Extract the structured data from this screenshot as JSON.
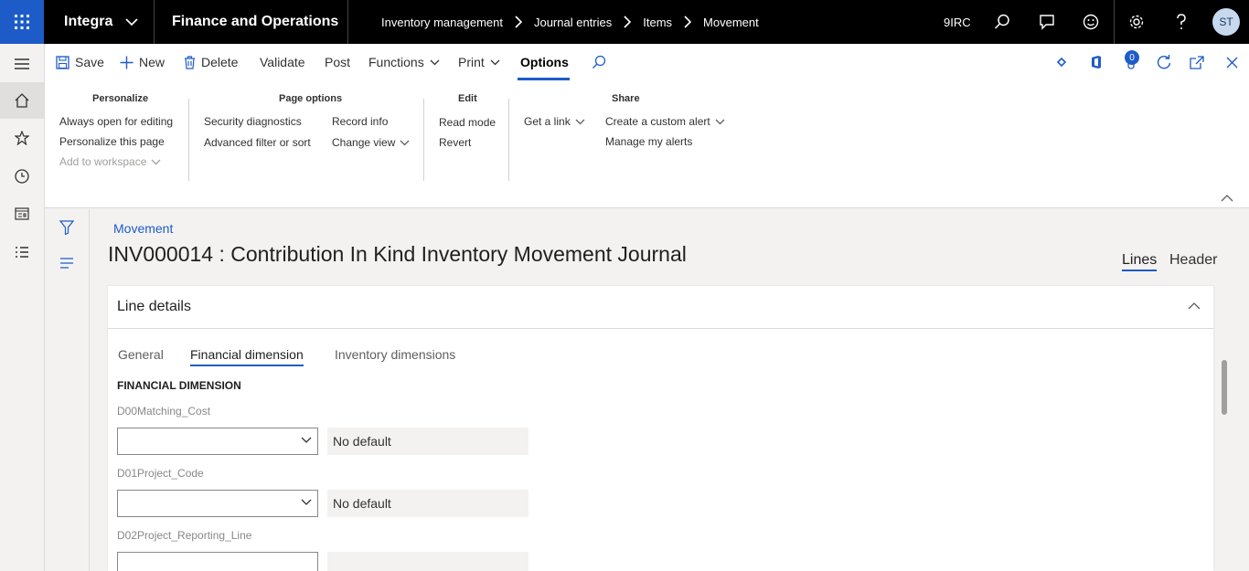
{
  "topbar": {
    "company": "Integra",
    "app_title": "Finance and Operations",
    "breadcrumbs": [
      "Inventory management",
      "Journal entries",
      "Items",
      "Movement"
    ],
    "legal_entity": "9IRC",
    "avatar_initials": "ST",
    "waffle_color": "#1d5cc8"
  },
  "actionpane": {
    "save": "Save",
    "new": "New",
    "delete": "Delete",
    "validate": "Validate",
    "post": "Post",
    "functions": "Functions",
    "print": "Print",
    "options": "Options",
    "notification_count": "0"
  },
  "ribbon": {
    "personalize": {
      "header": "Personalize",
      "always_open": "Always open for editing",
      "personalize_page": "Personalize this page",
      "add_workspace": "Add to workspace"
    },
    "page_options": {
      "header": "Page options",
      "security": "Security diagnostics",
      "advanced_filter": "Advanced filter or sort",
      "record_info": "Record info",
      "change_view": "Change view"
    },
    "edit": {
      "header": "Edit",
      "read_mode": "Read mode",
      "revert": "Revert"
    },
    "share": {
      "header": "Share",
      "get_link": "Get a link",
      "custom_alert": "Create a custom alert",
      "manage_alerts": "Manage my alerts"
    }
  },
  "page": {
    "caption": "Movement",
    "title": "INV000014 : Contribution In Kind Inventory Movement Journal",
    "tab_lines": "Lines",
    "tab_header": "Header"
  },
  "card": {
    "title": "Line details",
    "tabs": [
      "General",
      "Financial dimension",
      "Inventory dimensions"
    ],
    "group_title": "FINANCIAL DIMENSION",
    "fields": [
      {
        "label": "D00Matching_Cost",
        "value": "",
        "description": "No default"
      },
      {
        "label": "D01Project_Code",
        "value": "",
        "description": "No default"
      },
      {
        "label": "D02Project_Reporting_Line",
        "value": "",
        "description": ""
      }
    ]
  }
}
